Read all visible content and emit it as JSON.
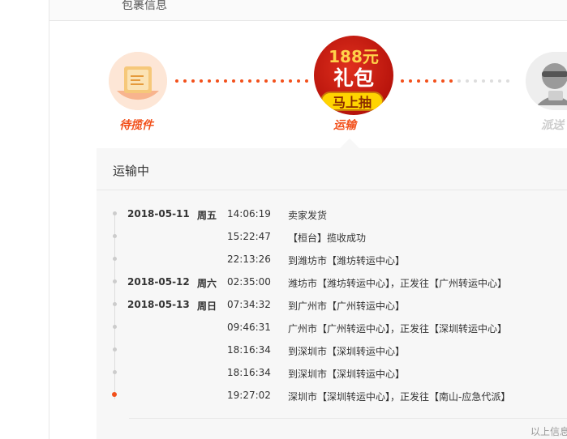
{
  "section": {
    "title": "包裹信息"
  },
  "steps": [
    {
      "label": "待揽件",
      "icon": "package-icon",
      "color": "#f2501b"
    },
    {
      "label": "运输",
      "icon": "truck-icon",
      "color": "#f2501b"
    },
    {
      "label": "派送",
      "icon": "courier-icon",
      "color": "#cccccc"
    }
  ],
  "promo": {
    "amount": "188元",
    "gift": "礼包",
    "cta": "马上抽"
  },
  "panel": {
    "title": "运输中",
    "footer": "以上信息"
  },
  "tracking": [
    {
      "date": "2018-05-11",
      "weekday": "周五",
      "time": "14:06:19",
      "desc": "卖家发货"
    },
    {
      "date": "",
      "weekday": "",
      "time": "15:22:47",
      "desc": "【桓台】揽收成功"
    },
    {
      "date": "",
      "weekday": "",
      "time": "22:13:26",
      "desc": "到潍坊市【潍坊转运中心】"
    },
    {
      "date": "2018-05-12",
      "weekday": "周六",
      "time": "02:35:00",
      "desc": "潍坊市【潍坊转运中心】，正发往【广州转运中心】"
    },
    {
      "date": "2018-05-13",
      "weekday": "周日",
      "time": "07:34:32",
      "desc": "到广州市【广州转运中心】"
    },
    {
      "date": "",
      "weekday": "",
      "time": "09:46:31",
      "desc": "广州市【广州转运中心】，正发往【深圳转运中心】"
    },
    {
      "date": "",
      "weekday": "",
      "time": "18:16:34",
      "desc": "到深圳市【深圳转运中心】"
    },
    {
      "date": "",
      "weekday": "",
      "time": "18:16:34",
      "desc": "到深圳市【深圳转运中心】"
    },
    {
      "date": "",
      "weekday": "",
      "time": "19:27:02",
      "desc": "深圳市【深圳转运中心】，正发往【南山-应急代派】"
    }
  ]
}
